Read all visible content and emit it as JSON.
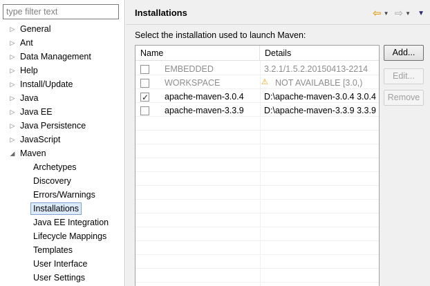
{
  "filter": {
    "placeholder": "type filter text"
  },
  "tree": {
    "items": [
      {
        "label": "General",
        "level": 0,
        "expanded": false
      },
      {
        "label": "Ant",
        "level": 0,
        "expanded": false
      },
      {
        "label": "Data Management",
        "level": 0,
        "expanded": false
      },
      {
        "label": "Help",
        "level": 0,
        "expanded": false
      },
      {
        "label": "Install/Update",
        "level": 0,
        "expanded": false
      },
      {
        "label": "Java",
        "level": 0,
        "expanded": false
      },
      {
        "label": "Java EE",
        "level": 0,
        "expanded": false
      },
      {
        "label": "Java Persistence",
        "level": 0,
        "expanded": false
      },
      {
        "label": "JavaScript",
        "level": 0,
        "expanded": false
      },
      {
        "label": "Maven",
        "level": 0,
        "expanded": true
      },
      {
        "label": "Archetypes",
        "level": 1
      },
      {
        "label": "Discovery",
        "level": 1
      },
      {
        "label": "Errors/Warnings",
        "level": 1
      },
      {
        "label": "Installations",
        "level": 1,
        "selected": true
      },
      {
        "label": "Java EE Integration",
        "level": 1
      },
      {
        "label": "Lifecycle Mappings",
        "level": 1
      },
      {
        "label": "Templates",
        "level": 1
      },
      {
        "label": "User Interface",
        "level": 1
      },
      {
        "label": "User Settings",
        "level": 1
      }
    ]
  },
  "page": {
    "title": "Installations",
    "instruction": "Select the installation used to launch Maven:"
  },
  "table": {
    "columns": [
      "Name",
      "Details"
    ],
    "rows": [
      {
        "checked": false,
        "disabled": true,
        "name": "EMBEDDED",
        "details": "3.2.1/1.5.2.20150413-2214",
        "warning": false
      },
      {
        "checked": false,
        "disabled": true,
        "name": "WORKSPACE",
        "details": "NOT AVAILABLE [3.0,)",
        "warning": true
      },
      {
        "checked": true,
        "disabled": false,
        "name": "apache-maven-3.0.4",
        "details": "D:\\apache-maven-3.0.4 3.0.4",
        "warning": false
      },
      {
        "checked": false,
        "disabled": false,
        "name": "apache-maven-3.3.9",
        "details": "D:\\apache-maven-3.3.9 3.3.9",
        "warning": false
      }
    ]
  },
  "buttons": {
    "add": "Add...",
    "edit": "Edit...",
    "remove": "Remove"
  },
  "icons": {
    "back": "arrow-left-icon",
    "forward": "arrow-right-icon",
    "menu": "view-menu-icon"
  },
  "colors": {
    "accent_back_arrow": "#e4a11b",
    "selection_bg": "#dceafc",
    "warning": "#e5a700"
  }
}
